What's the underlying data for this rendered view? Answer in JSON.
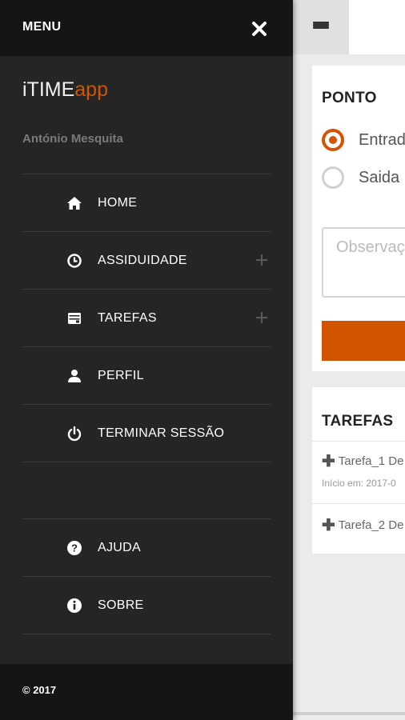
{
  "drawer": {
    "menu_label": "MENU",
    "brand_main": "iTIME",
    "brand_accent": "app",
    "user_name": "António Mesquita",
    "nav_items": [
      {
        "label": "HOME",
        "icon": "home-icon"
      },
      {
        "label": "ASSIDUIDADE",
        "icon": "clock-icon",
        "expandable": true
      },
      {
        "label": "TAREFAS",
        "icon": "wallet-icon",
        "expandable": true
      },
      {
        "label": "PERFIL",
        "icon": "user-icon"
      },
      {
        "label": "TERMINAR SESSÃO",
        "icon": "power-icon"
      }
    ],
    "secondary_items": [
      {
        "label": "AJUDA",
        "icon": "help-icon"
      },
      {
        "label": "SOBRE",
        "icon": "info-icon"
      }
    ],
    "footer": "© 2017"
  },
  "main": {
    "ponto": {
      "title": "PONTO",
      "options": [
        {
          "label": "Entrada",
          "selected": true
        },
        {
          "label": "Saida",
          "selected": false
        }
      ],
      "observations_placeholder": "Observações"
    },
    "tarefas": {
      "title": "TAREFAS",
      "items": [
        {
          "name": "Tarefa_1 De",
          "subtitle": "Início em: 2017-0"
        },
        {
          "name": "Tarefa_2 De"
        }
      ]
    }
  },
  "colors": {
    "accent": "#d35400",
    "drawer_bg": "#252525",
    "drawer_header_bg": "#151515"
  }
}
